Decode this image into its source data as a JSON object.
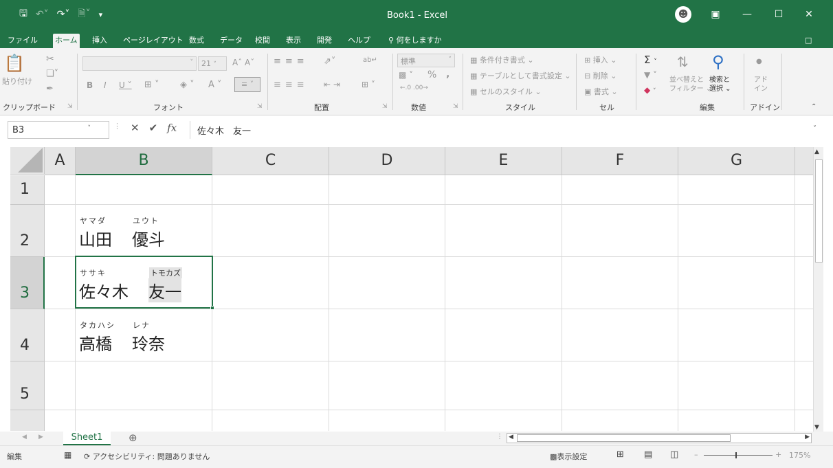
{
  "app": {
    "title": "Book1  -  Excel"
  },
  "ribbon_tabs": [
    "ファイル",
    "ホーム",
    "挿入",
    "ページレイアウト",
    "数式",
    "データ",
    "校閲",
    "表示",
    "開発",
    "ヘルプ"
  ],
  "tell_me": "何をしますか",
  "ribbon": {
    "clipboard": {
      "paste": "貼り付け",
      "label": "クリップボード"
    },
    "font": {
      "size": "21",
      "label": "フォント"
    },
    "alignment": {
      "label": "配置"
    },
    "number": {
      "format": "標準",
      "percent": "%",
      "comma": ",",
      "label": "数値"
    },
    "styles": {
      "conditional": "条件付き書式 ⌄",
      "table": "テーブルとして書式設定 ⌄",
      "cell": "セルのスタイル ⌄",
      "label": "スタイル"
    },
    "cells": {
      "insert": "挿入 ⌄",
      "delete": "削除 ⌄",
      "format": "書式 ⌄",
      "label": "セル"
    },
    "editing": {
      "sort": "並べ替えと\nフィルター ⌄",
      "find": "検索と\n選択 ⌄",
      "label": "編集"
    },
    "addins": {
      "addin": "アド\nイン",
      "label": "アドイン"
    }
  },
  "formula_bar": {
    "name_box": "B3",
    "fx": "fx",
    "content": "佐々木　友一"
  },
  "columns": [
    "A",
    "B",
    "C",
    "D",
    "E",
    "F",
    "G"
  ],
  "rows": [
    "1",
    "2",
    "3",
    "4",
    "5"
  ],
  "cells": {
    "B2": {
      "furigana_last": "ヤマダ",
      "furigana_first": "ユウト",
      "last": "山田",
      "first": "優斗"
    },
    "B3": {
      "furigana_last": "ササキ",
      "furigana_first": "トモカズ",
      "last": "佐々木",
      "first": "友一"
    },
    "B4": {
      "furigana_last": "タカハシ",
      "furigana_first": "レナ",
      "last": "高橋",
      "first": "玲奈"
    }
  },
  "sheets": [
    "Sheet1"
  ],
  "status": {
    "mode": "編集",
    "accessibility": "アクセシビリティ: 問題ありません",
    "display_settings": "表示設定",
    "zoom": "175%"
  },
  "colors": {
    "accent": "#217346"
  }
}
